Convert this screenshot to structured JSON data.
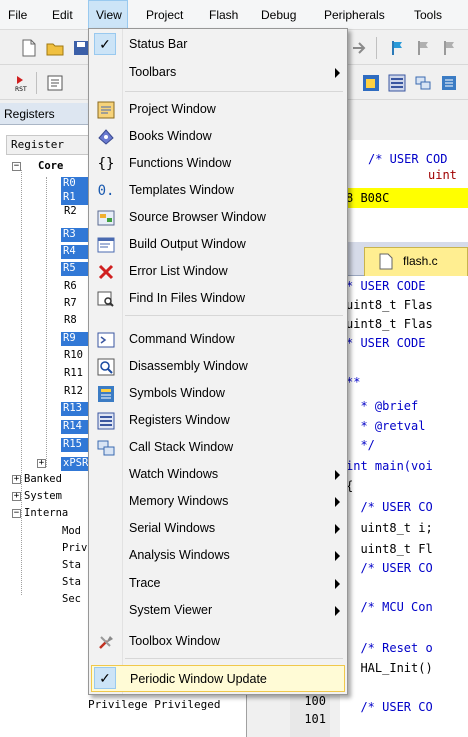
{
  "menubar": [
    "File",
    "Edit",
    "View",
    "Project",
    "Flash",
    "Debug",
    "Peripherals",
    "Tools"
  ],
  "registers": {
    "title": "Registers",
    "header": "Register",
    "core_label": "Core",
    "highlighted": [
      "R0",
      "R1",
      "R3",
      "R4",
      "R5",
      "R9",
      "R13",
      "R14",
      "R15",
      "xPSR"
    ],
    "plain": [
      "R2",
      "R6",
      "R7",
      "R8",
      "R10",
      "R11",
      "R12"
    ],
    "groups": [
      "Banked",
      "System",
      "Interna"
    ],
    "internal_children": [
      "Mod",
      "Priv",
      "Sta",
      "Sta",
      "Sec"
    ],
    "below_menu": "Privilege   Privileged"
  },
  "editor": {
    "top_lines": [
      "/* USER COD",
      "uint"
    ],
    "yellow_line": "8 B08C",
    "tab_label": "flash.c",
    "code_lines": [
      "* USER CODE",
      "uint8_t Flas",
      "uint8_t Flas",
      "* USER CODE",
      "",
      "**",
      "  * @brief",
      "  * @retval",
      "  */",
      "int main(voi",
      "{",
      "  /* USER CO",
      "  uint8_t i;",
      "  uint8_t Fl",
      "  /* USER CO",
      "",
      "  /* MCU Con",
      "",
      "  /* Reset o",
      "  HAL_Init()",
      "",
      "  /* USER CO"
    ],
    "line_numbers": [
      "100",
      "101"
    ]
  },
  "view_menu": {
    "items": [
      {
        "label": "Status Bar",
        "icon": "check-icon",
        "checked": true
      },
      {
        "label": "Toolbars",
        "submenu": true
      },
      {
        "label": "Project Window",
        "icon": "project-window-icon"
      },
      {
        "label": "Books Window",
        "icon": "books-icon"
      },
      {
        "label": "Functions Window",
        "icon": "functions-icon"
      },
      {
        "label": "Templates Window",
        "icon": "templates-icon"
      },
      {
        "label": "Source Browser Window",
        "icon": "source-browser-icon"
      },
      {
        "label": "Build Output Window",
        "icon": "build-output-icon"
      },
      {
        "label": "Error List Window",
        "icon": "error-x-icon"
      },
      {
        "label": "Find In Files Window",
        "icon": "find-in-files-icon"
      },
      {
        "label": "Command Window",
        "icon": "command-prompt-icon"
      },
      {
        "label": "Disassembly Window",
        "icon": "disassembly-icon"
      },
      {
        "label": "Symbols Window",
        "icon": "symbols-icon"
      },
      {
        "label": "Registers Window",
        "icon": "registers-icon"
      },
      {
        "label": "Call Stack Window",
        "icon": "call-stack-icon"
      },
      {
        "label": "Watch Windows",
        "submenu": true
      },
      {
        "label": "Memory Windows",
        "submenu": true
      },
      {
        "label": "Serial Windows",
        "submenu": true
      },
      {
        "label": "Analysis Windows",
        "submenu": true
      },
      {
        "label": "Trace",
        "submenu": true
      },
      {
        "label": "System Viewer",
        "submenu": true
      },
      {
        "label": "Toolbox Window",
        "icon": "toolbox-wrench-icon"
      },
      {
        "label": "Periodic Window Update",
        "icon": "check-icon",
        "checked": true,
        "highlighted": true
      }
    ]
  }
}
